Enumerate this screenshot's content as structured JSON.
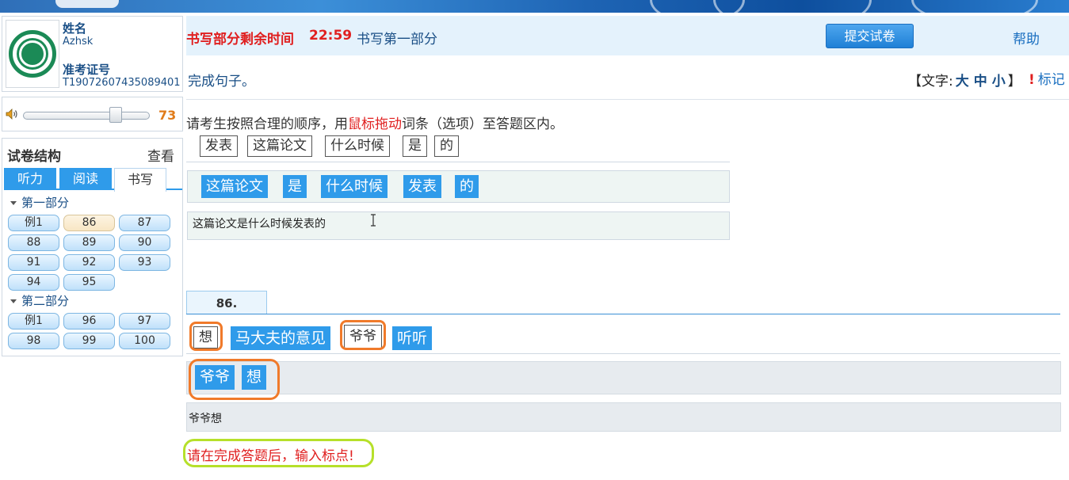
{
  "candidate": {
    "name_label": "姓名",
    "name_value": "Azhsk",
    "id_label": "准考证号",
    "id_value": "T19072607435089401"
  },
  "volume": {
    "value": "73",
    "level_fraction": 0.73
  },
  "structure": {
    "title": "试卷结构",
    "view_label": "查看",
    "tabs": [
      "听力",
      "阅读",
      "书写"
    ],
    "active_tab": "书写",
    "part1_label": "第一部分",
    "part1_items": [
      "例1",
      "86",
      "87",
      "88",
      "89",
      "90",
      "91",
      "92",
      "93",
      "94",
      "95"
    ],
    "part2_label": "第二部分",
    "part2_items": [
      "例1",
      "96",
      "97",
      "98",
      "99",
      "100"
    ],
    "current_item": "86"
  },
  "header": {
    "timer_label": "书写部分剩余时间",
    "timer_value": "22:59",
    "section_name": "书写第一部分",
    "submit_label": "提交试卷",
    "help_label": "帮助"
  },
  "task": {
    "title": "完成句子。",
    "font_prefix": "【文字:",
    "font_large": "大",
    "font_medium": "中",
    "font_small": "小",
    "font_suffix": "】",
    "mark_excl": "!",
    "mark_label": "标记"
  },
  "instruction": {
    "before": "请考生按照合理的顺序，用",
    "highlight": "鼠标拖动",
    "after": "词条（选项）至答题区内。"
  },
  "example": {
    "options": [
      "发表",
      "这篇论文",
      "什么时候",
      "是",
      "的"
    ],
    "arranged": [
      "这篇论文",
      "是",
      "什么时候",
      "发表",
      "的"
    ],
    "answer_text": "这篇论文是什么时候发表的"
  },
  "question": {
    "tab_label": "86.",
    "options": [
      "想",
      "马大夫的意见",
      "爷爷",
      "听听"
    ],
    "arranged": [
      "爷爷",
      "想"
    ],
    "answer_text": "爷爷想",
    "warning": "请在完成答题后，输入标点!"
  }
}
